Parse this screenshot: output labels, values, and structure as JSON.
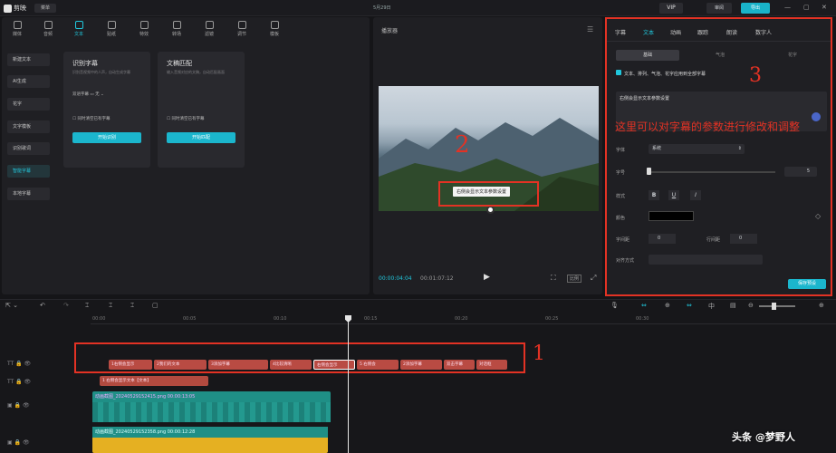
{
  "app": {
    "name": "剪映",
    "menu_label": "菜单",
    "window_title": "5月29日",
    "vip_label": "VIP",
    "share_label": "审阅",
    "export_label": "导出"
  },
  "media_tabs": [
    "媒体",
    "音频",
    "文本",
    "贴纸",
    "特效",
    "转场",
    "滤镜",
    "调节",
    "模板"
  ],
  "side_menu": [
    "新建文本",
    "AI生成",
    "花字",
    "文字模板",
    "识别歌词",
    "智能字幕",
    "本地字幕"
  ],
  "cards": [
    {
      "title": "识别字幕",
      "desc": "识别音视频中的人声，自动生成字幕",
      "select_label": "双语字幕",
      "select_value": "无",
      "checkbox": "同时清空已有字幕",
      "button": "开始识别"
    },
    {
      "title": "文稿匹配",
      "desc": "输入音频对应的文稿，自动匹配画面",
      "checkbox": "同时清空已有字幕",
      "button": "开始匹配"
    }
  ],
  "player": {
    "title": "播放器",
    "subtitle_text": "右侧会显示文本参数设置",
    "current_time": "00:00:04:04",
    "total_time": "00:01:07:12",
    "ratio_label": "比例"
  },
  "right_panel": {
    "tabs": [
      "字幕",
      "文本",
      "动画",
      "跟踪",
      "朗读",
      "数字人"
    ],
    "subtabs": [
      "基础",
      "气泡",
      "花字"
    ],
    "apply_all": "文本、排列、气泡、花字应用到全部字幕",
    "text_preview": "右侧会显示文本参数设置",
    "font_label": "字体",
    "font_value": "系统",
    "size_label": "字号",
    "size_value": "5",
    "style_label": "样式",
    "style_buttons": [
      "B",
      "U",
      "I"
    ],
    "color_label": "颜色",
    "spacing_label": "字间距",
    "spacing_value": "0",
    "line_label": "行间距",
    "line_value": "0",
    "align_label": "对齐方式",
    "save_preset": "保存预设"
  },
  "annotations": {
    "num1": "1",
    "num2": "2",
    "num3": "3",
    "note": "这里可以对字幕的参数进行修改和调整"
  },
  "timeline": {
    "ruler": [
      "00:00",
      "00:05",
      "00:10",
      "00:15",
      "00:20",
      "00:25",
      "00:30"
    ],
    "subtitle_clips": [
      "1右侧会显示",
      "2我们的文本",
      "3添加字幕",
      "4比较清晰",
      "5上面",
      "右侧会显示",
      "5 右侧会",
      "2添加字幕",
      "双击字幕",
      "对话框"
    ],
    "text_clip": "1 右侧会显示文本【文本】",
    "video_clip_1": {
      "name": "动画截图_20240529152415.png",
      "duration": "00:00:13:05"
    },
    "video_clip_2": {
      "name": "动画截图_20240529152358.png",
      "duration": "00:00:12:28"
    }
  },
  "watermark": "头条 @梦野人"
}
